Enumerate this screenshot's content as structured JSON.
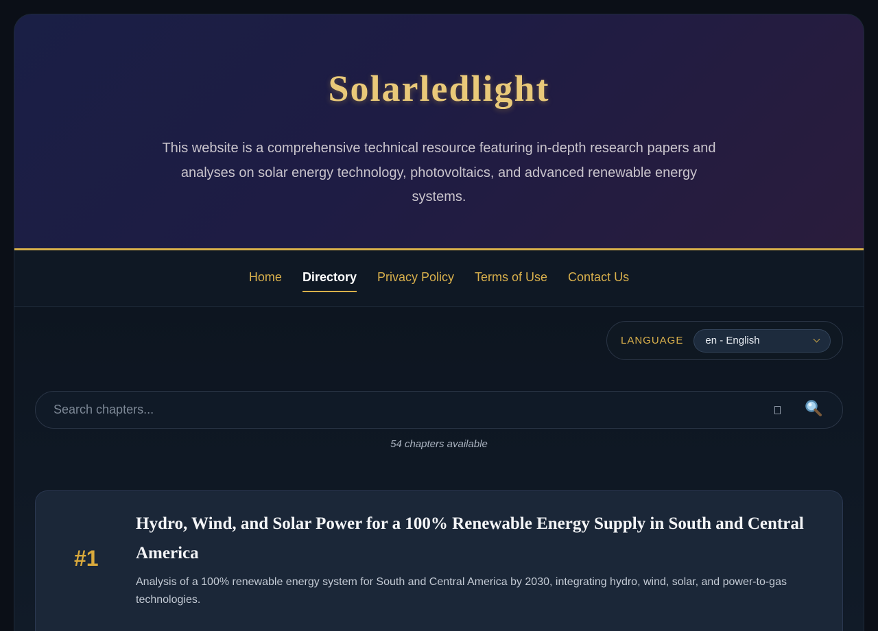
{
  "header": {
    "title": "Solarledlight",
    "description": "This website is a comprehensive technical resource featuring in-depth research papers and analyses on solar energy technology, photovoltaics, and advanced renewable energy systems."
  },
  "nav": {
    "items": [
      {
        "label": "Home"
      },
      {
        "label": "Directory"
      },
      {
        "label": "Privacy Policy"
      },
      {
        "label": "Terms of Use"
      },
      {
        "label": "Contact Us"
      }
    ]
  },
  "language": {
    "label": "LANGUAGE",
    "selected": "en - English"
  },
  "search": {
    "placeholder": "Search chapters...",
    "count_text": "54 chapters available"
  },
  "chapters": [
    {
      "number": "#1",
      "title": "Hydro, Wind, and Solar Power for a 100% Renewable Energy Supply in South and Central America",
      "description": "Analysis of a 100% renewable energy system for South and Central America by 2030, integrating hydro, wind, solar, and power-to-gas technologies."
    }
  ],
  "colors": {
    "accent": "#d8b04a",
    "background": "#0e1622"
  }
}
